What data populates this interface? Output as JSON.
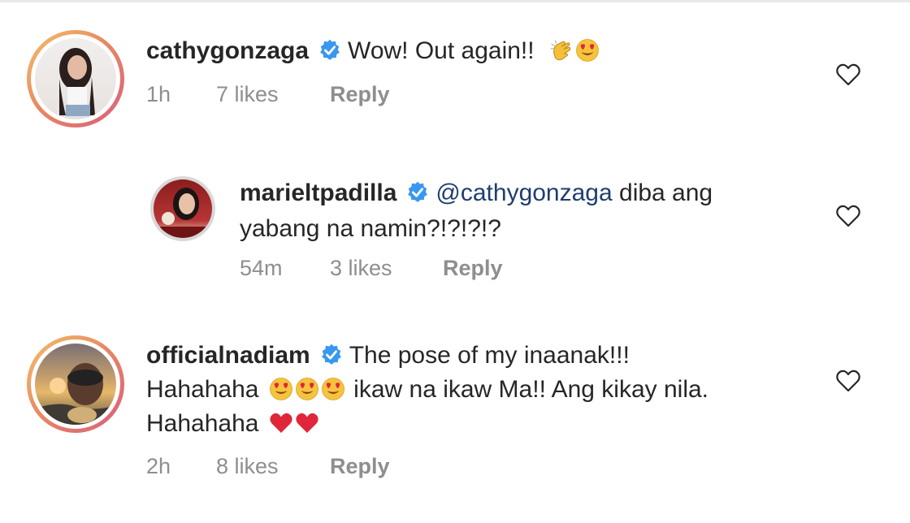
{
  "comments": [
    {
      "username": "cathygonzaga",
      "text": "Wow! Out again!!",
      "emojis": [
        "clapping-hands",
        "heart-eyes"
      ],
      "time": "1h",
      "likes": "7 likes",
      "reply": "Reply"
    },
    {
      "username": "marieltpadilla",
      "mention": "@cathygonzaga",
      "text": " diba ang",
      "text_line2": "yabang na namin?!?!?!?",
      "time": "54m",
      "likes": "3 likes",
      "reply": "Reply",
      "is_reply": true
    },
    {
      "username": "officialnadiam",
      "text": "The pose of my inaanak!!!",
      "text_line2_a": "Hahahaha",
      "emojis_line2": [
        "heart-eyes",
        "heart-eyes",
        "heart-eyes"
      ],
      "text_line2_b": "ikaw na ikaw Ma!! Ang kikay nila.",
      "text_line3": "Hahahaha",
      "emojis_line3": [
        "red-heart",
        "red-heart"
      ],
      "time": "2h",
      "likes": "8 likes",
      "reply": "Reply"
    }
  ],
  "colors": {
    "text": "#262626",
    "meta": "#8e8e8e",
    "verified": "#3897f0",
    "mention": "#1f3e6e"
  }
}
